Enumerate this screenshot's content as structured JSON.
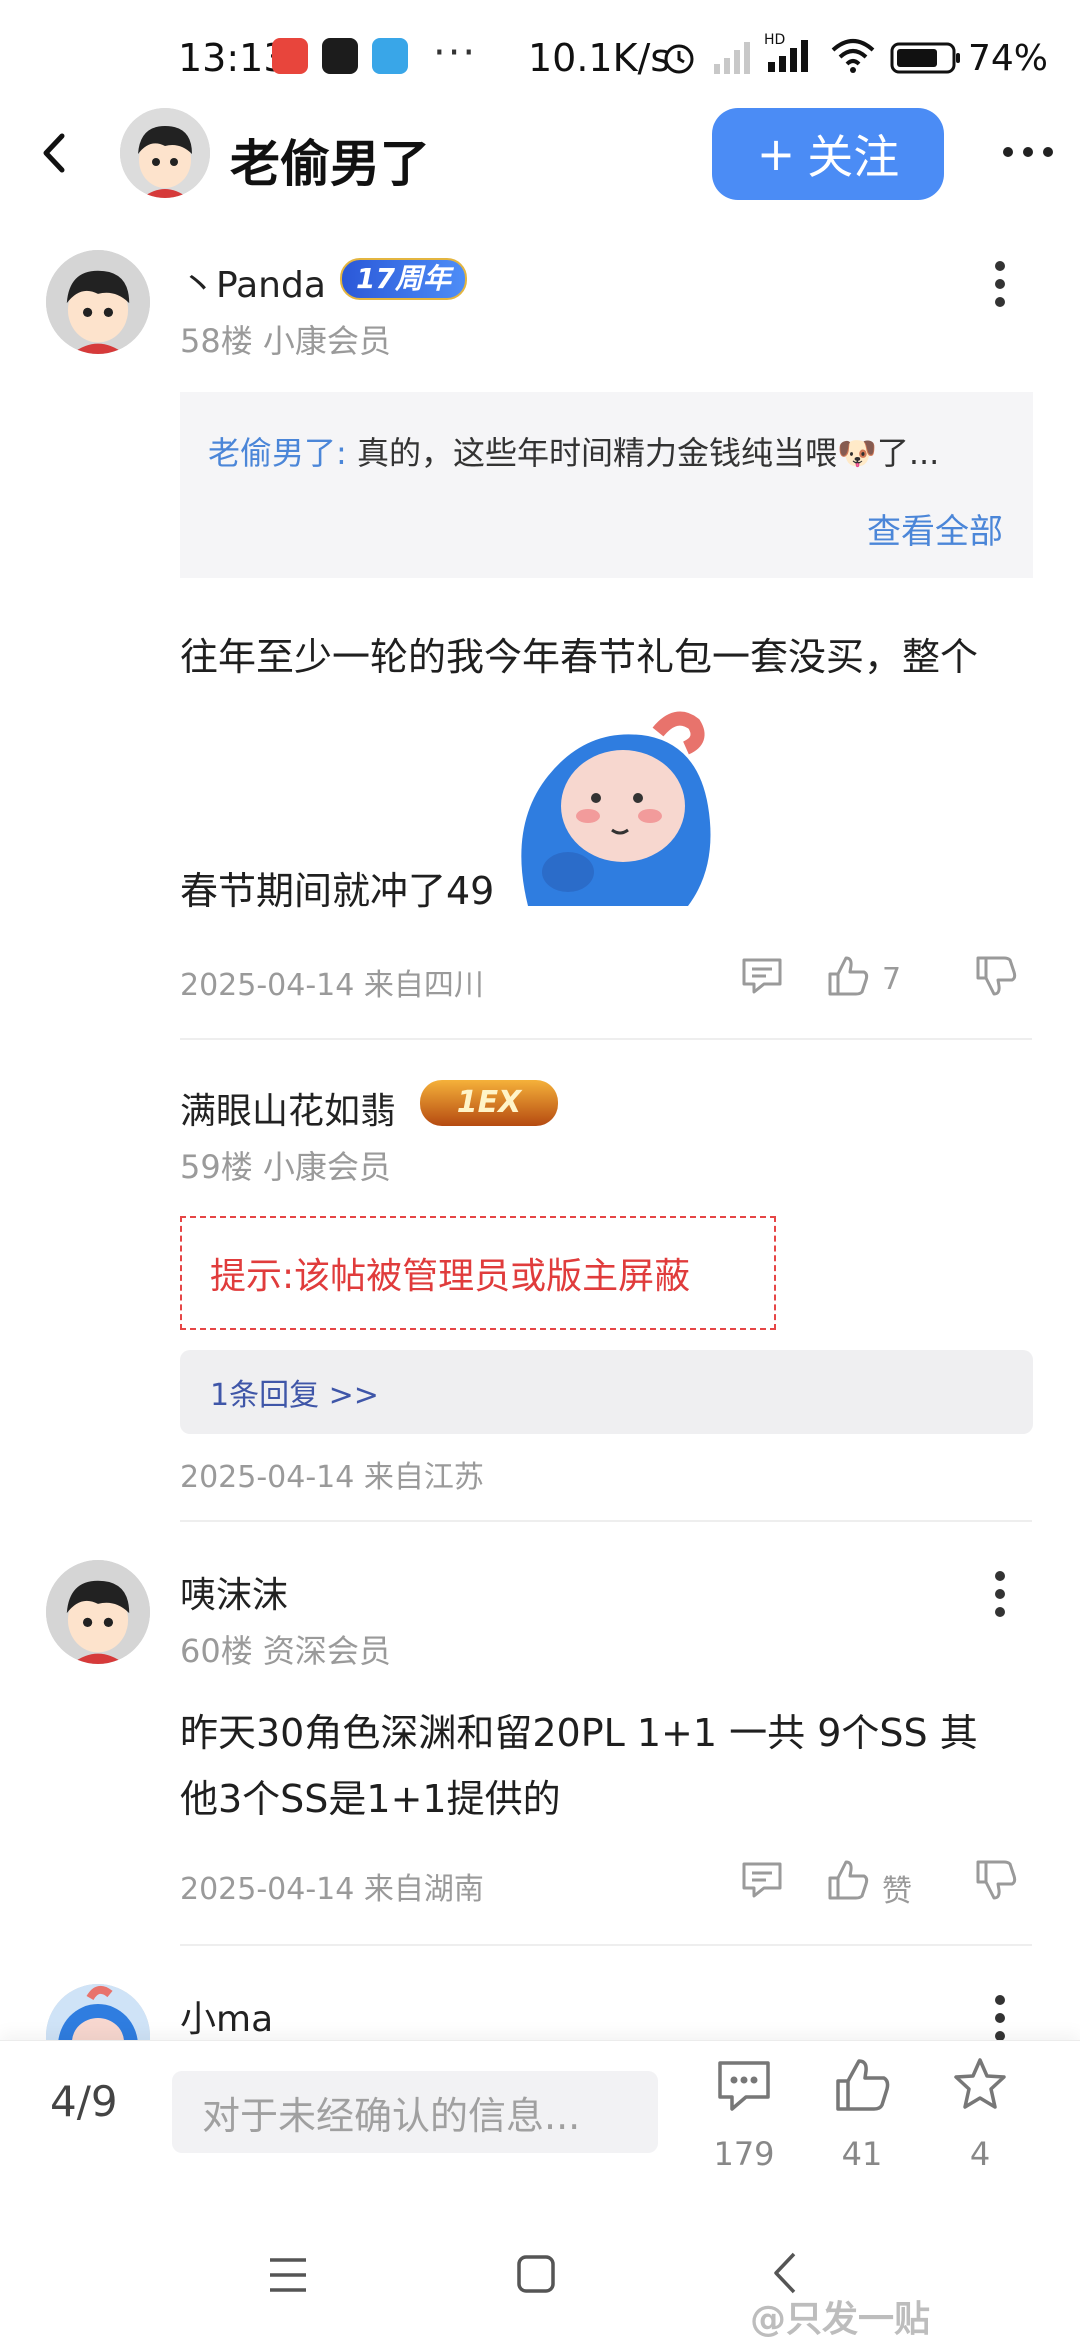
{
  "status_bar": {
    "time": "13:13",
    "dots": "···",
    "net_speed": "10.1K/s",
    "battery_pct": "74%"
  },
  "header": {
    "title": "老偷男了",
    "follow_label": "关注",
    "follow_plus": "+"
  },
  "posts": [
    {
      "username": "丶Panda",
      "badge_text": "17周年",
      "floor_member": "58楼  小康会员",
      "quote": {
        "author": "老偷男了:",
        "text": " 真的，这些年时间精力金钱纯当喂🐶了...",
        "more": "查看全部"
      },
      "content_line1": "往年至少一轮的我今年春节礼包一套没买，整个",
      "content_line2": "春节期间就冲了49",
      "date_location": "2025-04-14 来自四川",
      "like_count": "7"
    },
    {
      "username": "满眼山花如翡",
      "badge_text": "1EX",
      "floor_member": "59楼  小康会员",
      "blocked_notice": "提示:该帖被管理员或版主屏蔽",
      "reply_link": "1条回复 >>",
      "date_location": "2025-04-14 来自江苏"
    },
    {
      "username": "咦沫沫",
      "floor_member": "60楼  资深会员",
      "content_line1": "昨天30角色深渊和留20PL 1+1   一共 9个SS  其",
      "content_line2": "他3个SS是1+1提供的",
      "date_location": "2025-04-14 来自湖南",
      "like_label": "赞"
    },
    {
      "username": "小ma"
    }
  ],
  "bottom_bar": {
    "page_indicator": "4/9",
    "input_placeholder": "对于未经确认的信息...",
    "comment_count": "179",
    "like_count": "41",
    "favorite_count": "4"
  },
  "watermark": "@只发一贴",
  "colors": {
    "accent": "#4b8cf5",
    "link": "#4b86d8",
    "warning": "#e03c3c"
  }
}
